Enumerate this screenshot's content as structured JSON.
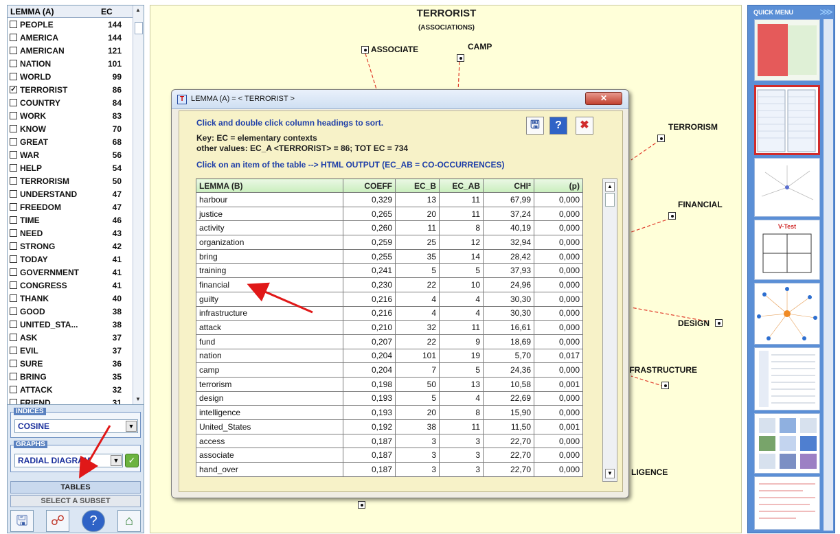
{
  "left_panel": {
    "header_lemma": "LEMMA (A)",
    "header_ec": "EC",
    "lemmas": [
      {
        "word": "PEOPLE",
        "ec": "144",
        "checked": false
      },
      {
        "word": "AMERICA",
        "ec": "144",
        "checked": false
      },
      {
        "word": "AMERICAN",
        "ec": "121",
        "checked": false
      },
      {
        "word": "NATION",
        "ec": "101",
        "checked": false
      },
      {
        "word": "WORLD",
        "ec": "99",
        "checked": false
      },
      {
        "word": "TERRORIST",
        "ec": "86",
        "checked": true
      },
      {
        "word": "COUNTRY",
        "ec": "84",
        "checked": false
      },
      {
        "word": "WORK",
        "ec": "83",
        "checked": false
      },
      {
        "word": "KNOW",
        "ec": "70",
        "checked": false
      },
      {
        "word": "GREAT",
        "ec": "68",
        "checked": false
      },
      {
        "word": "WAR",
        "ec": "56",
        "checked": false
      },
      {
        "word": "HELP",
        "ec": "54",
        "checked": false
      },
      {
        "word": "TERRORISM",
        "ec": "50",
        "checked": false
      },
      {
        "word": "UNDERSTAND",
        "ec": "47",
        "checked": false
      },
      {
        "word": "FREEDOM",
        "ec": "47",
        "checked": false
      },
      {
        "word": "TIME",
        "ec": "46",
        "checked": false
      },
      {
        "word": "NEED",
        "ec": "43",
        "checked": false
      },
      {
        "word": "STRONG",
        "ec": "42",
        "checked": false
      },
      {
        "word": "TODAY",
        "ec": "41",
        "checked": false
      },
      {
        "word": "GOVERNMENT",
        "ec": "41",
        "checked": false
      },
      {
        "word": "CONGRESS",
        "ec": "41",
        "checked": false
      },
      {
        "word": "THANK",
        "ec": "40",
        "checked": false
      },
      {
        "word": "GOOD",
        "ec": "38",
        "checked": false
      },
      {
        "word": "UNITED_STA...",
        "ec": "38",
        "checked": false
      },
      {
        "word": "ASK",
        "ec": "37",
        "checked": false
      },
      {
        "word": "EVIL",
        "ec": "37",
        "checked": false
      },
      {
        "word": "SURE",
        "ec": "36",
        "checked": false
      },
      {
        "word": "BRING",
        "ec": "35",
        "checked": false
      },
      {
        "word": "ATTACK",
        "ec": "32",
        "checked": false
      },
      {
        "word": "FRIEND",
        "ec": "31",
        "checked": false
      }
    ],
    "indices_label": "INDICES",
    "indices_value": "COSINE",
    "graphs_label": "GRAPHS",
    "graphs_value": "RADIAL DIAGRAM",
    "tables_label": "TABLES",
    "subset_label": "SELECT A SUBSET",
    "bottom_icons": [
      "save-icon",
      "network-icon",
      "help-icon",
      "home-icon"
    ]
  },
  "canvas": {
    "title": "TERRORIST",
    "subtitle": "(ASSOCIATIONS)",
    "nodes": {
      "associate": "ASSOCIATE",
      "camp": "CAMP",
      "terrorism": "TERRORISM",
      "financial": "FINANCIAL",
      "design": "DESIGN",
      "infrastructure": "IFRASTRUCTURE",
      "intelligence": "LIGENCE"
    }
  },
  "quick_menu": {
    "title": "QUICK MENU",
    "vtest_label": "V-Test"
  },
  "dialog": {
    "title": "LEMMA (A) = < TERRORIST >",
    "instruction": "Click and double click column headings to sort.",
    "key_line": "Key: EC = elementary contexts",
    "values_line": "other values: EC_A <TERRORIST> = 86; TOT EC = 734",
    "html_hint": "Click on an item of the table --> HTML OUTPUT (EC_AB = CO-OCCURRENCES)",
    "columns": [
      "LEMMA (B)",
      "COEFF",
      "EC_B",
      "EC_AB",
      "CHI²",
      "(p)"
    ],
    "rows": [
      [
        "harbour",
        "0,329",
        "13",
        "11",
        "67,99",
        "0,000"
      ],
      [
        "justice",
        "0,265",
        "20",
        "11",
        "37,24",
        "0,000"
      ],
      [
        "activity",
        "0,260",
        "11",
        "8",
        "40,19",
        "0,000"
      ],
      [
        "organization",
        "0,259",
        "25",
        "12",
        "32,94",
        "0,000"
      ],
      [
        "bring",
        "0,255",
        "35",
        "14",
        "28,42",
        "0,000"
      ],
      [
        "training",
        "0,241",
        "5",
        "5",
        "37,93",
        "0,000"
      ],
      [
        "financial",
        "0,230",
        "22",
        "10",
        "24,96",
        "0,000"
      ],
      [
        "guilty",
        "0,216",
        "4",
        "4",
        "30,30",
        "0,000"
      ],
      [
        "infrastructure",
        "0,216",
        "4",
        "4",
        "30,30",
        "0,000"
      ],
      [
        "attack",
        "0,210",
        "32",
        "11",
        "16,61",
        "0,000"
      ],
      [
        "fund",
        "0,207",
        "22",
        "9",
        "18,69",
        "0,000"
      ],
      [
        "nation",
        "0,204",
        "101",
        "19",
        "5,70",
        "0,017"
      ],
      [
        "camp",
        "0,204",
        "7",
        "5",
        "24,36",
        "0,000"
      ],
      [
        "terrorism",
        "0,198",
        "50",
        "13",
        "10,58",
        "0,001"
      ],
      [
        "design",
        "0,193",
        "5",
        "4",
        "22,69",
        "0,000"
      ],
      [
        "intelligence",
        "0,193",
        "20",
        "8",
        "15,90",
        "0,000"
      ],
      [
        "United_States",
        "0,192",
        "38",
        "11",
        "11,50",
        "0,001"
      ],
      [
        "access",
        "0,187",
        "3",
        "3",
        "22,70",
        "0,000"
      ],
      [
        "associate",
        "0,187",
        "3",
        "3",
        "22,70",
        "0,000"
      ],
      [
        "hand_over",
        "0,187",
        "3",
        "3",
        "22,70",
        "0,000"
      ]
    ]
  },
  "colors": {
    "canvas_bg": "#ffffd9",
    "quick_menu_bg": "#5b8fd6",
    "annotation_arrow": "#e01818",
    "table_header": "#c9eebd"
  }
}
